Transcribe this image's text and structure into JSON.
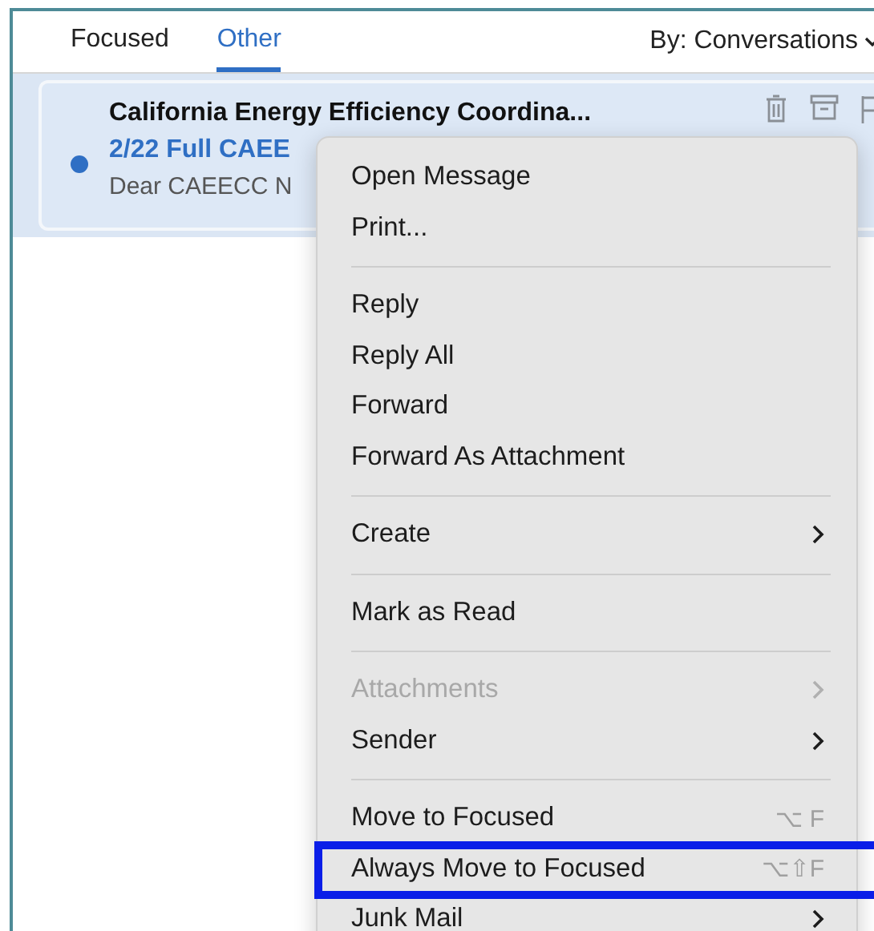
{
  "tabs": [
    {
      "label": "Focused",
      "selected": false
    },
    {
      "label": "Other",
      "selected": true
    }
  ],
  "sort": {
    "label": "By: Conversations"
  },
  "message": {
    "sender": "California Energy Efficiency Coordina...",
    "subject": "2/22 Full CAEE",
    "preview": "Dear CAEECC N",
    "unread": true,
    "selected": true
  },
  "context_menu": [
    {
      "kind": "item",
      "label": "Open Message"
    },
    {
      "kind": "item",
      "label": "Print..."
    },
    {
      "kind": "separator"
    },
    {
      "kind": "item",
      "label": "Reply"
    },
    {
      "kind": "item",
      "label": "Reply All"
    },
    {
      "kind": "item",
      "label": "Forward"
    },
    {
      "kind": "item",
      "label": "Forward As Attachment"
    },
    {
      "kind": "separator"
    },
    {
      "kind": "item",
      "label": "Create",
      "submenu": true
    },
    {
      "kind": "separator"
    },
    {
      "kind": "item",
      "label": "Mark as Read"
    },
    {
      "kind": "separator"
    },
    {
      "kind": "item",
      "label": "Attachments",
      "submenu": true,
      "disabled": true
    },
    {
      "kind": "item",
      "label": "Sender",
      "submenu": true
    },
    {
      "kind": "separator"
    },
    {
      "kind": "item",
      "label": "Move to Focused",
      "shortcut": "⌥ F"
    },
    {
      "kind": "item",
      "label": "Always Move to Focused",
      "shortcut": "⌥⇧F",
      "highlighted": true
    },
    {
      "kind": "item",
      "label": "Junk Mail",
      "submenu": true
    }
  ]
}
